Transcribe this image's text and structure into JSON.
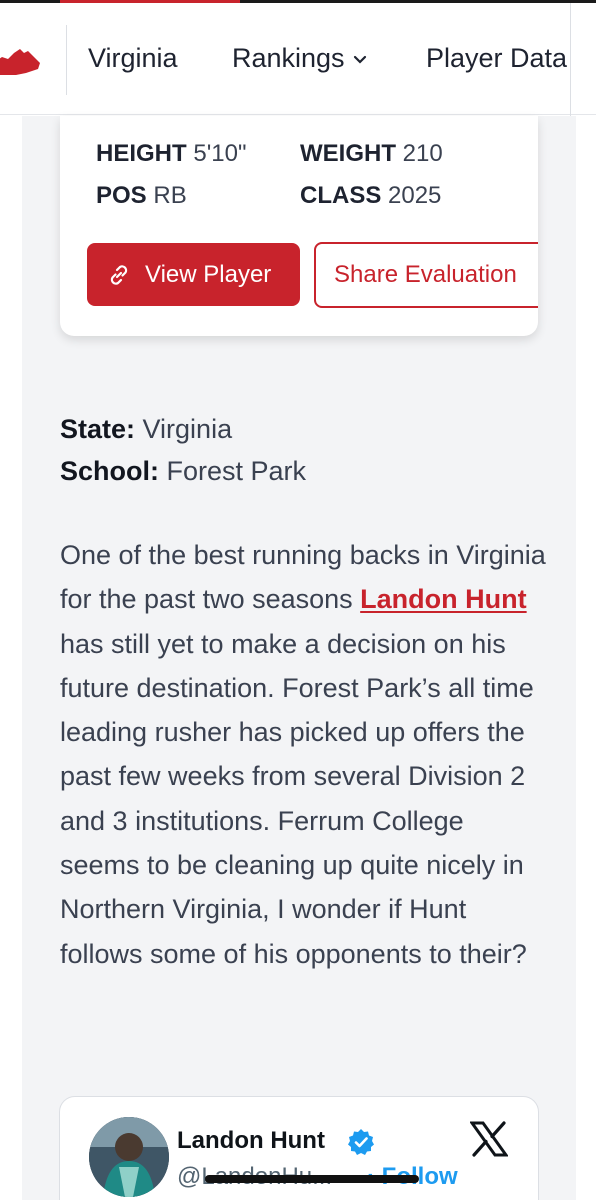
{
  "nav": {
    "logo_icon": "virginia-state-icon",
    "items": [
      {
        "label": "Virginia"
      },
      {
        "label": "Rankings",
        "has_dropdown": true
      },
      {
        "label": "Player Data"
      }
    ]
  },
  "player_card": {
    "height_label": "HEIGHT",
    "height_value": "5'10\"",
    "weight_label": "WEIGHT",
    "weight_value": "210",
    "pos_label": "POS",
    "pos_value": "RB",
    "class_label": "CLASS",
    "class_value": "2025",
    "view_button": "View Player",
    "share_button": "Share Evaluation"
  },
  "meta": {
    "state_label": "State:",
    "state_value": "Virginia",
    "school_label": "School:",
    "school_value": "Forest Park"
  },
  "article": {
    "before_link": "One of the best running backs in Virginia for the past two seasons ",
    "link_text": "Landon Hunt",
    "after_link": " has still yet to make a decision on his future destination. Forest Park’s all time leading rusher has picked up offers the past few weeks from several Division 2 and 3 institutions. Ferrum College seems to be cleaning up quite nicely in Northern Virginia, I wonder if Hunt follows some of his opponents to their?"
  },
  "tweet": {
    "name": "Landon Hunt",
    "handle": "@LandonHu...",
    "follow": "· Follow",
    "platform_icon": "x-logo-icon"
  },
  "colors": {
    "accent": "#c8232c",
    "link_blue": "#1d9bf0",
    "panel_bg": "#f3f4f6"
  }
}
